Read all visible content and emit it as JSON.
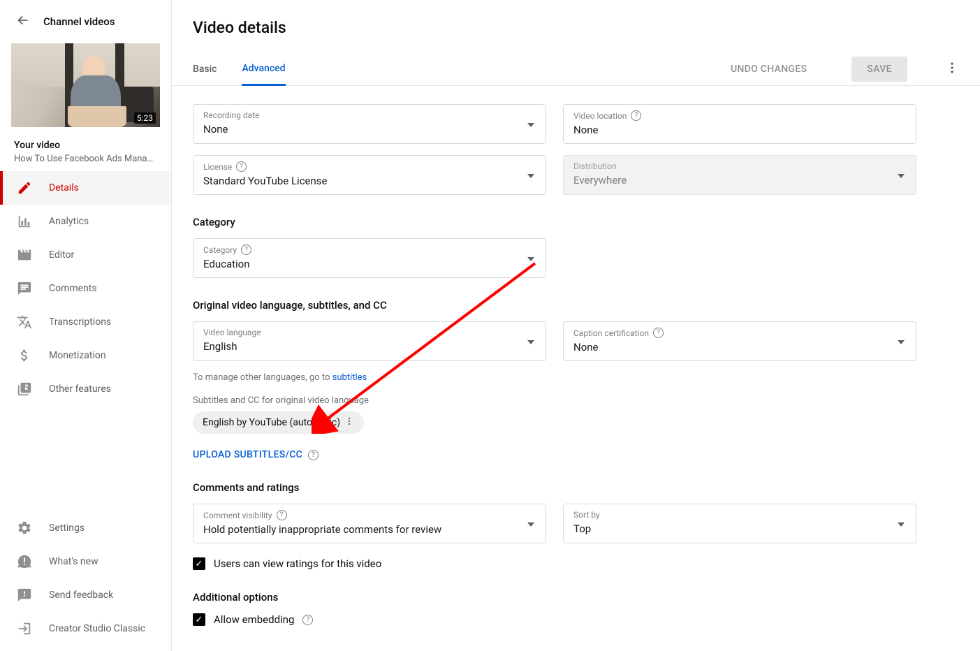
{
  "header": {
    "channel_link": "Channel videos"
  },
  "video": {
    "duration": "5:23",
    "your_video_label": "Your video",
    "title": "How To Use Facebook Ads Manager…"
  },
  "nav": {
    "details": "Details",
    "analytics": "Analytics",
    "editor": "Editor",
    "comments": "Comments",
    "transcriptions": "Transcriptions",
    "monetization": "Monetization",
    "other": "Other features",
    "settings": "Settings",
    "whatsnew": "What's new",
    "feedback": "Send feedback",
    "classic": "Creator Studio Classic"
  },
  "page": {
    "title": "Video details",
    "tab_basic": "Basic",
    "tab_advanced": "Advanced",
    "undo": "UNDO CHANGES",
    "save": "SAVE"
  },
  "fields": {
    "recording_date": {
      "label": "Recording date",
      "value": "None"
    },
    "video_location": {
      "label": "Video location",
      "value": "None"
    },
    "license": {
      "label": "License",
      "value": "Standard YouTube License"
    },
    "distribution": {
      "label": "Distribution",
      "value": "Everywhere"
    },
    "category_section": "Category",
    "category": {
      "label": "Category",
      "value": "Education"
    },
    "lang_section": "Original video language, subtitles, and CC",
    "video_language": {
      "label": "Video language",
      "value": "English"
    },
    "caption_cert": {
      "label": "Caption certification",
      "value": "None"
    },
    "manage_help_prefix": "To manage other languages, go to ",
    "manage_help_link": "subtitles",
    "subcc_label": "Subtitles and CC for original video language",
    "chip_text": "English by YouTube (automatic)",
    "upload_cc": "UPLOAD SUBTITLES/CC",
    "comments_section": "Comments and ratings",
    "comment_vis": {
      "label": "Comment visibility",
      "value": "Hold potentially inappropriate comments for review"
    },
    "sortby": {
      "label": "Sort by",
      "value": "Top"
    },
    "ratings_cb": "Users can view ratings for this video",
    "additional_section": "Additional options",
    "embed_cb": "Allow embedding"
  }
}
